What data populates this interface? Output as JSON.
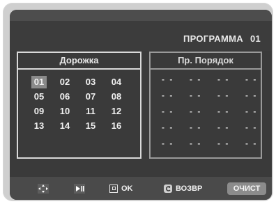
{
  "title": "ПРОГРАММА",
  "program_number": "01",
  "left_panel": {
    "heading": "Дорожка",
    "tracks": [
      "01",
      "02",
      "03",
      "04",
      "05",
      "06",
      "07",
      "08",
      "09",
      "10",
      "11",
      "12",
      "13",
      "14",
      "15",
      "16"
    ],
    "selected": "01"
  },
  "right_panel": {
    "heading": "Пр. Порядок",
    "rows": 5,
    "columns": 4,
    "placeholder": "- -"
  },
  "controls": {
    "ok_label": "OK",
    "back_label": "ВОЗВР",
    "clear_label": "ОЧИСТ"
  },
  "icons": [
    "move-icon",
    "play-pause-icon",
    "enter-icon",
    "return-icon"
  ],
  "colors": {
    "screen": "#3a3a3a",
    "panel_border": "#d9d9d9",
    "selected_cell": "#8a8a8a",
    "clear_button": "#8c8c8c"
  }
}
